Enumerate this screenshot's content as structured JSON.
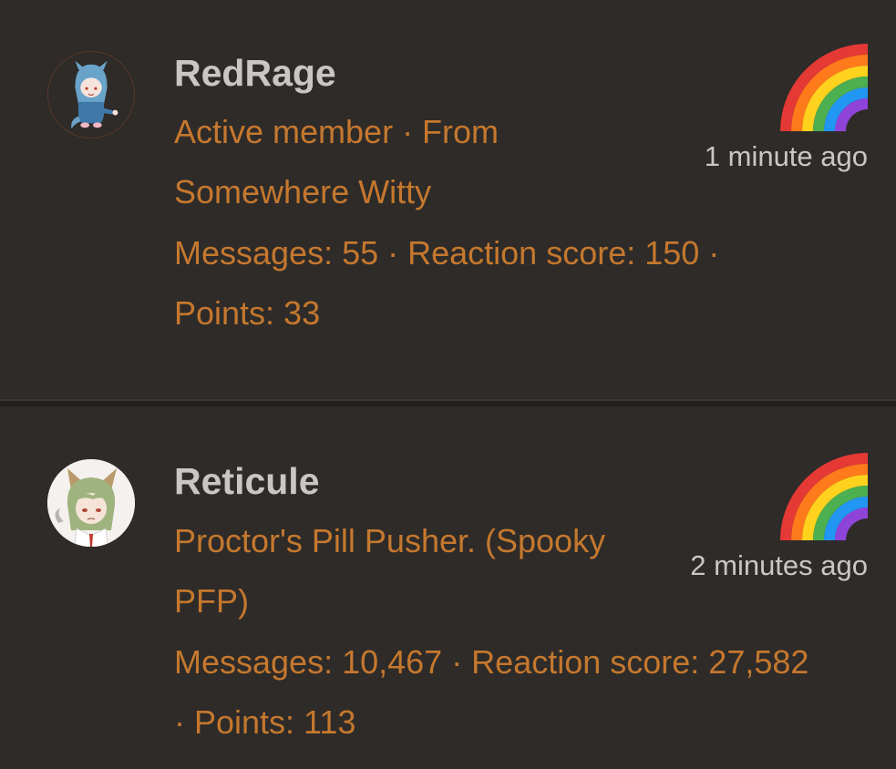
{
  "posts": [
    {
      "username": "RedRage",
      "title_line1": "Active member · From",
      "title_line2": "Somewhere Witty",
      "stats_line1": "Messages: 55 · Reaction score: 150 ·",
      "stats_line2": "Points: 33",
      "time": "1 minute ago",
      "badge_icon": "rainbow-icon",
      "avatar": "avatar-blue-hood-character"
    },
    {
      "username": "Reticule",
      "title_line1": "Proctor's Pill Pusher. (Spooky",
      "title_line2": "PFP)",
      "stats_line1": "Messages: 10,467 · Reaction score: 27,582",
      "stats_line2": "· Points: 113",
      "time": "2 minutes ago",
      "badge_icon": "rainbow-icon",
      "avatar": "avatar-green-hair-character"
    }
  ],
  "colors": {
    "background": "#2e2b29",
    "username": "#c9c7c5",
    "info_text": "#c5782e",
    "time_text": "#c9c7c5"
  }
}
